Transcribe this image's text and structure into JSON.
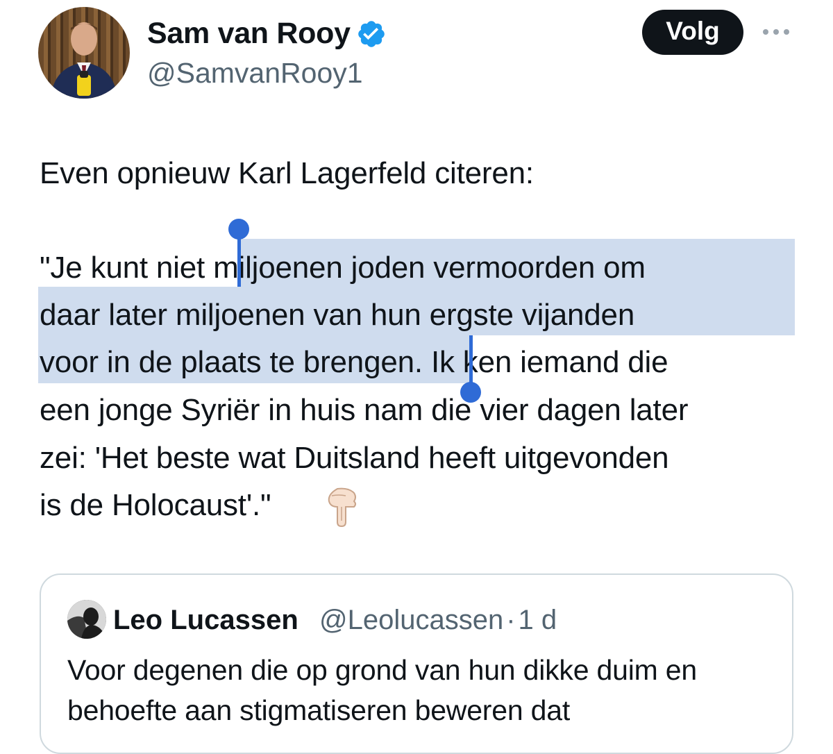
{
  "author": {
    "display_name": "Sam van Rooy",
    "handle": "@SamvanRooy1",
    "verified": true
  },
  "actions": {
    "follow_label": "Volg"
  },
  "tweet": {
    "lines": [
      "Even opnieuw Karl Lagerfeld citeren:",
      "\"Je kunt niet miljoenen joden vermoorden om",
      "daar later miljoenen van hun ergste vijanden",
      "voor in de plaats te brengen. Ik ken iemand die",
      "een jonge Syriër in huis nam die vier dagen later",
      "zei: 'Het beste wat Duitsland heeft uitgevonden",
      "is de Holocaust'.\""
    ],
    "emoji": "backhand-index-pointing-down"
  },
  "selection": {
    "selected_text": "miljoenen joden vermoorden om daar later miljoenen van hun ergste vijanden voor in de plaats te brengen",
    "highlight_color": "#cfdcee",
    "handle_color": "#2f6bd6"
  },
  "quoted_tweet": {
    "display_name": "Leo Lucassen",
    "handle": "@Leolucassen",
    "separator": "·",
    "time": "1 d",
    "lines": [
      "Voor degenen die op grond van hun dikke duim en",
      "behoefte aan stigmatiseren beweren dat"
    ]
  },
  "colors": {
    "text": "#0f1419",
    "secondary": "#536471",
    "verified": "#1d9bf0",
    "button_bg": "#0f1419",
    "border": "#cfd9de"
  }
}
